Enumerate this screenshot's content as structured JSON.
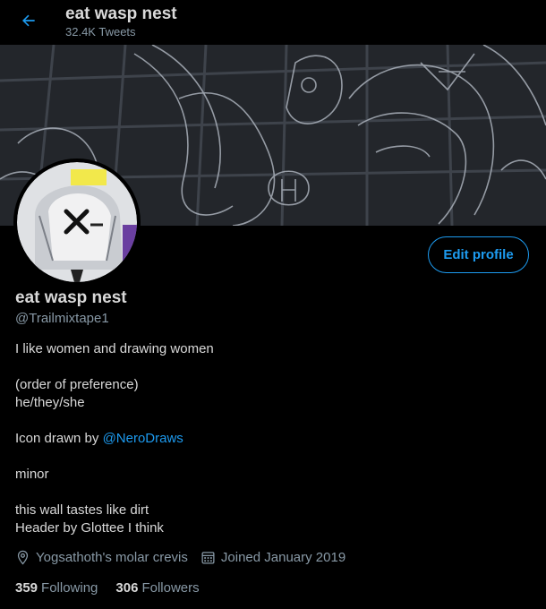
{
  "header": {
    "title": "eat wasp nest",
    "tweet_count": "32.4K Tweets"
  },
  "profile": {
    "name": "eat wasp nest",
    "handle": "@Trailmixtape1",
    "edit_label": "Edit profile"
  },
  "bio": {
    "line1": "I like women and drawing women",
    "line2": "(order of preference)",
    "line3": "he/they/she",
    "icon_prefix": "Icon drawn by ",
    "icon_link": "@NeroDraws",
    "line5": "minor",
    "line6": "this wall tastes like dirt",
    "line7": "Header by Glottee I think"
  },
  "meta": {
    "location": "Yogsathoth's molar crevis",
    "joined": "Joined January 2019"
  },
  "stats": {
    "following_count": "359",
    "following_label": "Following",
    "followers_count": "306",
    "followers_label": "Followers"
  },
  "colors": {
    "accent": "#1d9bf0",
    "background": "#000000",
    "text": "#d9d9d9",
    "muted": "#8899a6"
  },
  "icons": {
    "back": "back-arrow-icon",
    "location": "location-pin-icon",
    "calendar": "calendar-icon"
  }
}
